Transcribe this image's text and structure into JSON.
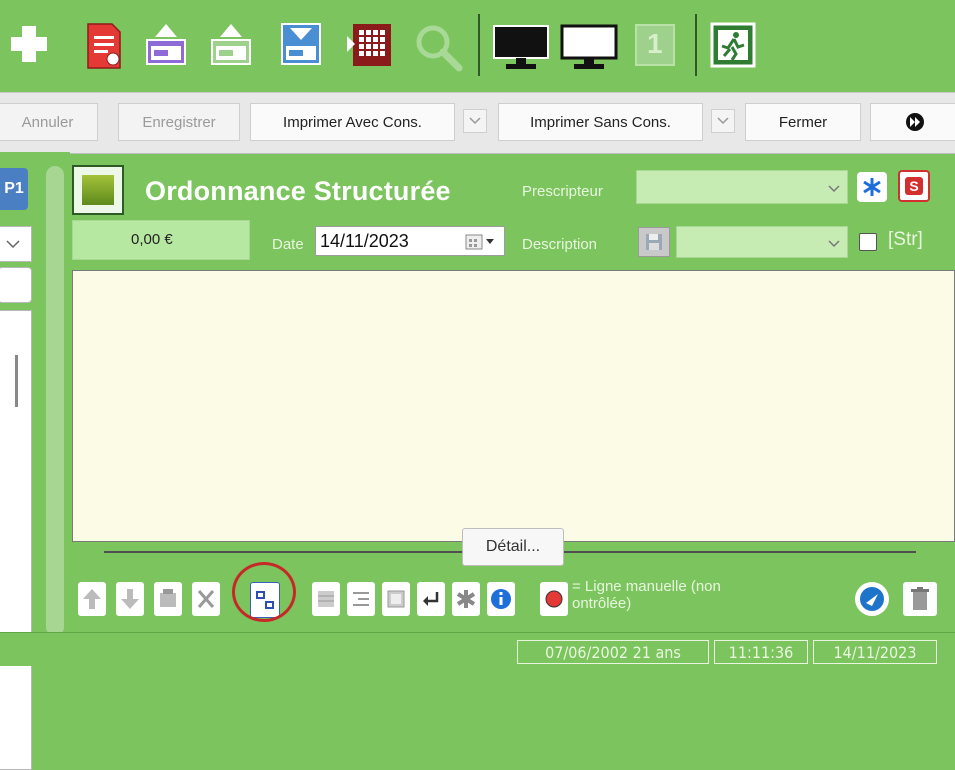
{
  "toolbar_icons": [
    "add-icon",
    "new-document-icon",
    "upload-purple-icon",
    "upload-green-icon",
    "download-blue-icon",
    "import-grid-icon",
    "search-icon",
    "monitor-black-icon",
    "monitor-white-icon",
    "page-one-icon",
    "exit-icon"
  ],
  "page_number_badge": "1",
  "actions": {
    "cancel": "Annuler",
    "save": "Enregistrer",
    "print_with": "Imprimer Avec Cons.",
    "print_without": "Imprimer Sans Cons.",
    "close": "Fermer"
  },
  "left": {
    "tab_label": "P1"
  },
  "header": {
    "title": "Ordonnance Structurée",
    "prescriber_label": "Prescripteur",
    "prescriber_value": "",
    "amount": "0,00 €",
    "date_label": "Date",
    "date_value": "14/11/2023",
    "description_label": "Description",
    "description_value": "",
    "str_label": "[Str]"
  },
  "detail_tooltip": "Détail...",
  "legend_text_line1": "= Ligne manuelle (non",
  "legend_text_line2": "ontrôlée)",
  "status": {
    "birth": "07/06/2002 21 ans",
    "time": "11:11:36",
    "date": "14/11/2023"
  },
  "colors": {
    "accent_green": "#7cc45d",
    "field_green": "#c6ecb4",
    "textarea_bg": "#fcfce6",
    "highlight_circle": "#c62828"
  }
}
